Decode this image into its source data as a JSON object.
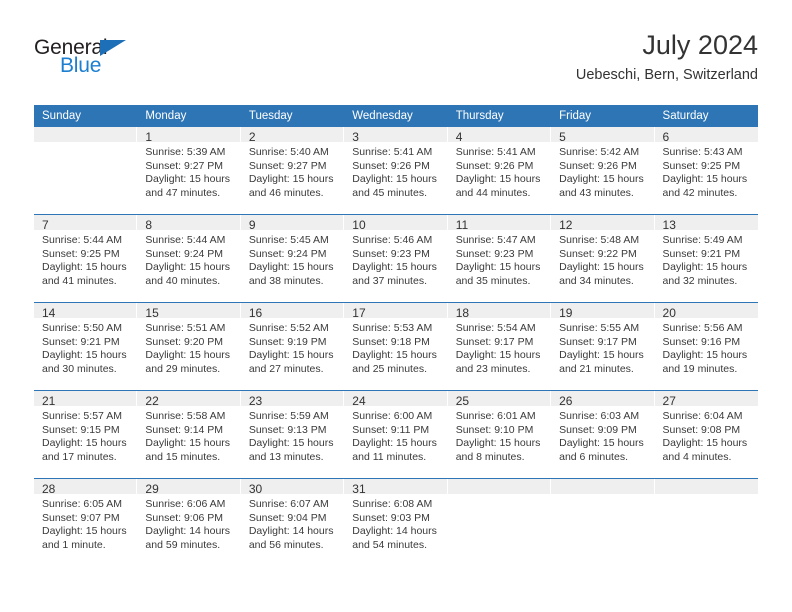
{
  "brand": {
    "name_dark": "General",
    "name_light": "Blue",
    "triangle_color": "#1d6fb8",
    "blue_text_color": "#1d7fd0"
  },
  "header": {
    "title": "July 2024",
    "subtitle": "Uebeschi, Bern, Switzerland"
  },
  "theme": {
    "header_blue": "#2e75b6",
    "daynum_band": "#efefef",
    "text": "#333333"
  },
  "weekday_headers": [
    "Sunday",
    "Monday",
    "Tuesday",
    "Wednesday",
    "Thursday",
    "Friday",
    "Saturday"
  ],
  "weeks": [
    [
      {
        "day": "",
        "sunrise": "",
        "sunset": "",
        "daylight_1": "",
        "daylight_2": ""
      },
      {
        "day": "1",
        "sunrise": "Sunrise: 5:39 AM",
        "sunset": "Sunset: 9:27 PM",
        "daylight_1": "Daylight: 15 hours",
        "daylight_2": "and 47 minutes."
      },
      {
        "day": "2",
        "sunrise": "Sunrise: 5:40 AM",
        "sunset": "Sunset: 9:27 PM",
        "daylight_1": "Daylight: 15 hours",
        "daylight_2": "and 46 minutes."
      },
      {
        "day": "3",
        "sunrise": "Sunrise: 5:41 AM",
        "sunset": "Sunset: 9:26 PM",
        "daylight_1": "Daylight: 15 hours",
        "daylight_2": "and 45 minutes."
      },
      {
        "day": "4",
        "sunrise": "Sunrise: 5:41 AM",
        "sunset": "Sunset: 9:26 PM",
        "daylight_1": "Daylight: 15 hours",
        "daylight_2": "and 44 minutes."
      },
      {
        "day": "5",
        "sunrise": "Sunrise: 5:42 AM",
        "sunset": "Sunset: 9:26 PM",
        "daylight_1": "Daylight: 15 hours",
        "daylight_2": "and 43 minutes."
      },
      {
        "day": "6",
        "sunrise": "Sunrise: 5:43 AM",
        "sunset": "Sunset: 9:25 PM",
        "daylight_1": "Daylight: 15 hours",
        "daylight_2": "and 42 minutes."
      }
    ],
    [
      {
        "day": "7",
        "sunrise": "Sunrise: 5:44 AM",
        "sunset": "Sunset: 9:25 PM",
        "daylight_1": "Daylight: 15 hours",
        "daylight_2": "and 41 minutes."
      },
      {
        "day": "8",
        "sunrise": "Sunrise: 5:44 AM",
        "sunset": "Sunset: 9:24 PM",
        "daylight_1": "Daylight: 15 hours",
        "daylight_2": "and 40 minutes."
      },
      {
        "day": "9",
        "sunrise": "Sunrise: 5:45 AM",
        "sunset": "Sunset: 9:24 PM",
        "daylight_1": "Daylight: 15 hours",
        "daylight_2": "and 38 minutes."
      },
      {
        "day": "10",
        "sunrise": "Sunrise: 5:46 AM",
        "sunset": "Sunset: 9:23 PM",
        "daylight_1": "Daylight: 15 hours",
        "daylight_2": "and 37 minutes."
      },
      {
        "day": "11",
        "sunrise": "Sunrise: 5:47 AM",
        "sunset": "Sunset: 9:23 PM",
        "daylight_1": "Daylight: 15 hours",
        "daylight_2": "and 35 minutes."
      },
      {
        "day": "12",
        "sunrise": "Sunrise: 5:48 AM",
        "sunset": "Sunset: 9:22 PM",
        "daylight_1": "Daylight: 15 hours",
        "daylight_2": "and 34 minutes."
      },
      {
        "day": "13",
        "sunrise": "Sunrise: 5:49 AM",
        "sunset": "Sunset: 9:21 PM",
        "daylight_1": "Daylight: 15 hours",
        "daylight_2": "and 32 minutes."
      }
    ],
    [
      {
        "day": "14",
        "sunrise": "Sunrise: 5:50 AM",
        "sunset": "Sunset: 9:21 PM",
        "daylight_1": "Daylight: 15 hours",
        "daylight_2": "and 30 minutes."
      },
      {
        "day": "15",
        "sunrise": "Sunrise: 5:51 AM",
        "sunset": "Sunset: 9:20 PM",
        "daylight_1": "Daylight: 15 hours",
        "daylight_2": "and 29 minutes."
      },
      {
        "day": "16",
        "sunrise": "Sunrise: 5:52 AM",
        "sunset": "Sunset: 9:19 PM",
        "daylight_1": "Daylight: 15 hours",
        "daylight_2": "and 27 minutes."
      },
      {
        "day": "17",
        "sunrise": "Sunrise: 5:53 AM",
        "sunset": "Sunset: 9:18 PM",
        "daylight_1": "Daylight: 15 hours",
        "daylight_2": "and 25 minutes."
      },
      {
        "day": "18",
        "sunrise": "Sunrise: 5:54 AM",
        "sunset": "Sunset: 9:17 PM",
        "daylight_1": "Daylight: 15 hours",
        "daylight_2": "and 23 minutes."
      },
      {
        "day": "19",
        "sunrise": "Sunrise: 5:55 AM",
        "sunset": "Sunset: 9:17 PM",
        "daylight_1": "Daylight: 15 hours",
        "daylight_2": "and 21 minutes."
      },
      {
        "day": "20",
        "sunrise": "Sunrise: 5:56 AM",
        "sunset": "Sunset: 9:16 PM",
        "daylight_1": "Daylight: 15 hours",
        "daylight_2": "and 19 minutes."
      }
    ],
    [
      {
        "day": "21",
        "sunrise": "Sunrise: 5:57 AM",
        "sunset": "Sunset: 9:15 PM",
        "daylight_1": "Daylight: 15 hours",
        "daylight_2": "and 17 minutes."
      },
      {
        "day": "22",
        "sunrise": "Sunrise: 5:58 AM",
        "sunset": "Sunset: 9:14 PM",
        "daylight_1": "Daylight: 15 hours",
        "daylight_2": "and 15 minutes."
      },
      {
        "day": "23",
        "sunrise": "Sunrise: 5:59 AM",
        "sunset": "Sunset: 9:13 PM",
        "daylight_1": "Daylight: 15 hours",
        "daylight_2": "and 13 minutes."
      },
      {
        "day": "24",
        "sunrise": "Sunrise: 6:00 AM",
        "sunset": "Sunset: 9:11 PM",
        "daylight_1": "Daylight: 15 hours",
        "daylight_2": "and 11 minutes."
      },
      {
        "day": "25",
        "sunrise": "Sunrise: 6:01 AM",
        "sunset": "Sunset: 9:10 PM",
        "daylight_1": "Daylight: 15 hours",
        "daylight_2": "and 8 minutes."
      },
      {
        "day": "26",
        "sunrise": "Sunrise: 6:03 AM",
        "sunset": "Sunset: 9:09 PM",
        "daylight_1": "Daylight: 15 hours",
        "daylight_2": "and 6 minutes."
      },
      {
        "day": "27",
        "sunrise": "Sunrise: 6:04 AM",
        "sunset": "Sunset: 9:08 PM",
        "daylight_1": "Daylight: 15 hours",
        "daylight_2": "and 4 minutes."
      }
    ],
    [
      {
        "day": "28",
        "sunrise": "Sunrise: 6:05 AM",
        "sunset": "Sunset: 9:07 PM",
        "daylight_1": "Daylight: 15 hours",
        "daylight_2": "and 1 minute."
      },
      {
        "day": "29",
        "sunrise": "Sunrise: 6:06 AM",
        "sunset": "Sunset: 9:06 PM",
        "daylight_1": "Daylight: 14 hours",
        "daylight_2": "and 59 minutes."
      },
      {
        "day": "30",
        "sunrise": "Sunrise: 6:07 AM",
        "sunset": "Sunset: 9:04 PM",
        "daylight_1": "Daylight: 14 hours",
        "daylight_2": "and 56 minutes."
      },
      {
        "day": "31",
        "sunrise": "Sunrise: 6:08 AM",
        "sunset": "Sunset: 9:03 PM",
        "daylight_1": "Daylight: 14 hours",
        "daylight_2": "and 54 minutes."
      },
      {
        "day": "",
        "sunrise": "",
        "sunset": "",
        "daylight_1": "",
        "daylight_2": ""
      },
      {
        "day": "",
        "sunrise": "",
        "sunset": "",
        "daylight_1": "",
        "daylight_2": ""
      },
      {
        "day": "",
        "sunrise": "",
        "sunset": "",
        "daylight_1": "",
        "daylight_2": ""
      }
    ]
  ]
}
